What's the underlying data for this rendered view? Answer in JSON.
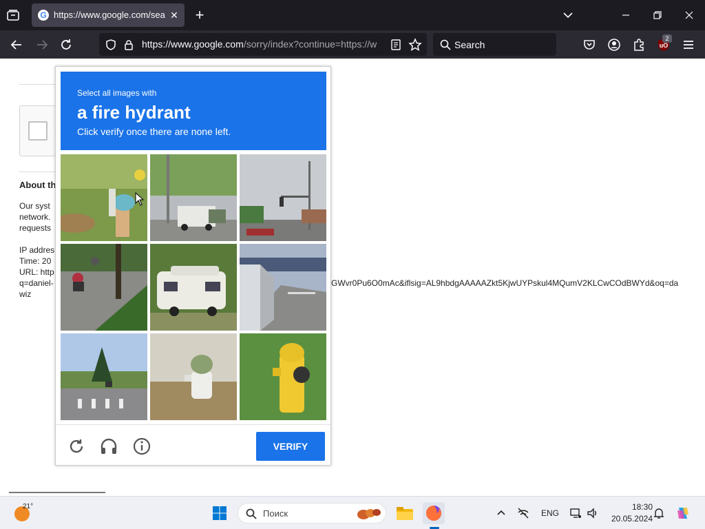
{
  "browser": {
    "tab_title": "https://www.google.com/search",
    "url_domain": "https://www.google.com",
    "url_path": "/sorry/index?continue=https://w",
    "search_placeholder": "Search",
    "ublock_badge": "2"
  },
  "page": {
    "about_heading": "About th",
    "para1": [
      "Our syst",
      "network.",
      "requests"
    ],
    "ip_lines": [
      "IP addres",
      "Time: 20",
      "URL: http",
      "q=daniel-",
      "wiz"
    ],
    "url_tail": "GWvr0Pu6O0mAc&iflsig=AL9hbdgAAAAAZkt5KjwUYPskul4MQumV2KLCwCOdBWYd&oq=da"
  },
  "captcha": {
    "line1": "Select all images with",
    "line2": "a fire hydrant",
    "line3": "Click verify once there are none left.",
    "verify_label": "VERIFY",
    "tiles": [
      "hydrant with blue cap on grass",
      "truck on road with trees",
      "street with traffic lights",
      "motorcyclists on street",
      "camper van parked",
      "truck on highway",
      "crosswalk street",
      "white hydrant green cap",
      "yellow hydrant on grass"
    ]
  },
  "taskbar": {
    "temperature": "21°",
    "search_placeholder": "Поиск",
    "language": "ENG",
    "time": "18:30",
    "date": "20.05.2024"
  }
}
